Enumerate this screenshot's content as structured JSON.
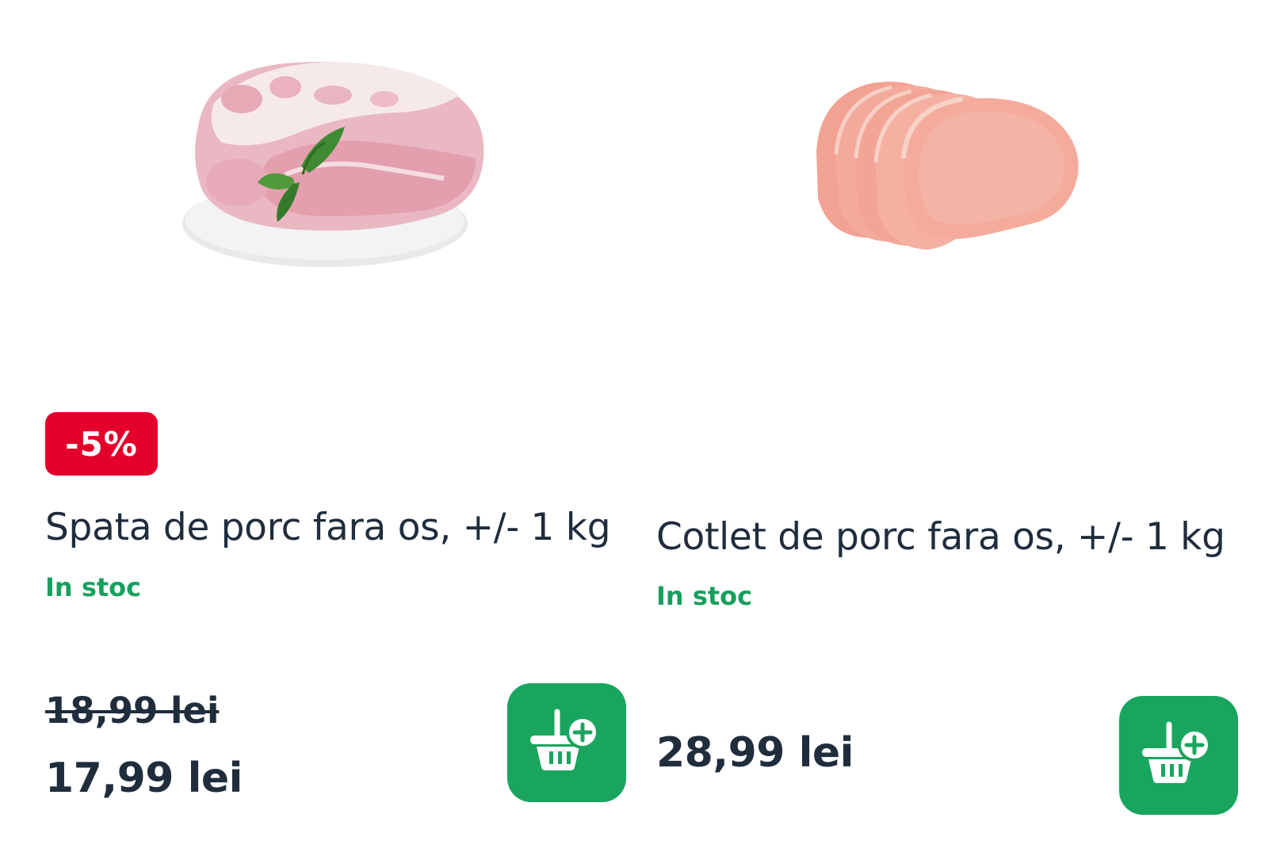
{
  "products": [
    {
      "image_alt": "pork-shoulder-image",
      "discount": "-5%",
      "name": "Spata de porc fara os, +/- 1 kg",
      "stock": "In stoc",
      "old_price": "18,99 lei",
      "price": "17,99 lei",
      "add_icon": "basket-plus-icon"
    },
    {
      "image_alt": "pork-chops-image",
      "name": "Cotlet de porc fara os, +/- 1 kg",
      "stock": "In stoc",
      "price": "28,99 lei",
      "add_icon": "basket-plus-icon"
    }
  ],
  "colors": {
    "discount_badge": "#e3002b",
    "stock_green": "#17a05d",
    "button_green": "#1aa55f",
    "text_dark": "#1f2d3d"
  }
}
